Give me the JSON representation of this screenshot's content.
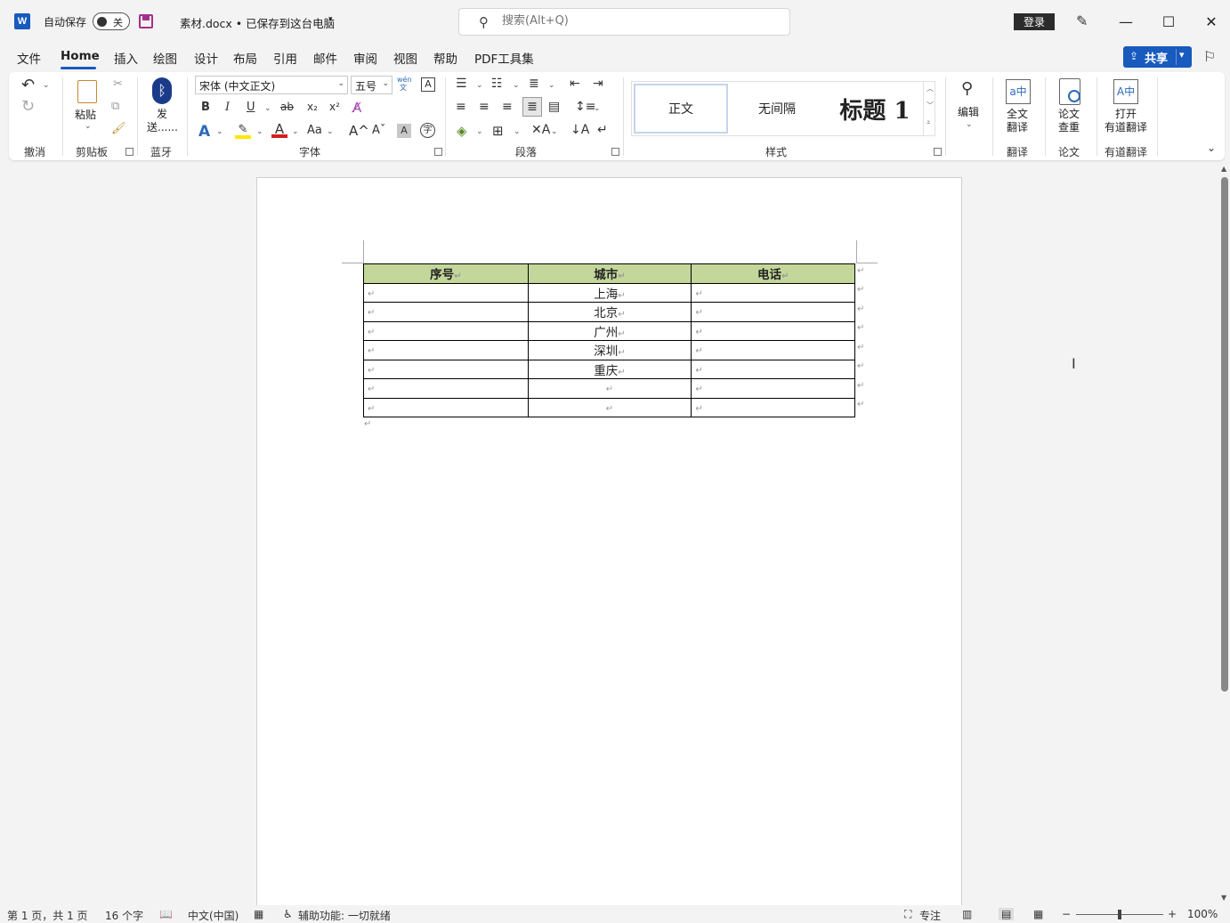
{
  "titlebar": {
    "app_icon": "W",
    "autosave_label": "自动保存",
    "autosave_state": "关",
    "doc_title": "素材.docx • 已保存到这台电脑",
    "search_placeholder": "搜索(Alt+Q)",
    "login_label": "登录",
    "minimize": "—",
    "maximize": "☐",
    "close": "✕"
  },
  "menu": {
    "tabs": [
      "文件",
      "Home",
      "插入",
      "绘图",
      "设计",
      "布局",
      "引用",
      "邮件",
      "审阅",
      "视图",
      "帮助",
      "PDF工具集"
    ],
    "active_tab": "Home",
    "share_label": "共享"
  },
  "ribbon": {
    "groups": {
      "undo": "撤消",
      "clipboard": "剪贴板",
      "bluetooth": "蓝牙",
      "font": "字体",
      "paragraph": "段落",
      "styles": "样式",
      "translate": "翻译",
      "paper": "论文",
      "youdao": "有道翻译"
    },
    "paste_label": "粘贴",
    "send_label_1": "发",
    "send_label_2": "送......",
    "font_name": "宋体 (中文正文)",
    "font_size": "五号",
    "phonetic": "wén 文",
    "styles": [
      "正文",
      "无间隔",
      "标题 1"
    ],
    "edit_label": "编辑",
    "full_translate_1": "全文",
    "full_translate_2": "翻译",
    "paper_check_1": "论文",
    "paper_check_2": "查重",
    "open_youdao_1": "打开",
    "open_youdao_2": "有道翻译",
    "font_buttons": [
      "B",
      "I",
      "U",
      "ab",
      "x₂",
      "x²"
    ],
    "case_label": "Aa"
  },
  "document": {
    "table": {
      "headers": [
        "序号",
        "城市",
        "电话"
      ],
      "rows": [
        [
          "",
          "上海",
          ""
        ],
        [
          "",
          "北京",
          ""
        ],
        [
          "",
          "广州",
          ""
        ],
        [
          "",
          "深圳",
          ""
        ],
        [
          "",
          "重庆",
          ""
        ],
        [
          "",
          "",
          ""
        ],
        [
          "",
          "",
          ""
        ]
      ]
    },
    "para_mark": "↵"
  },
  "statusbar": {
    "page": "第 1 页，共 1 页",
    "words": "16 个字",
    "language": "中文(中国)",
    "accessibility": "辅助功能: 一切就绪",
    "focus": "专注",
    "zoom": "100%"
  }
}
